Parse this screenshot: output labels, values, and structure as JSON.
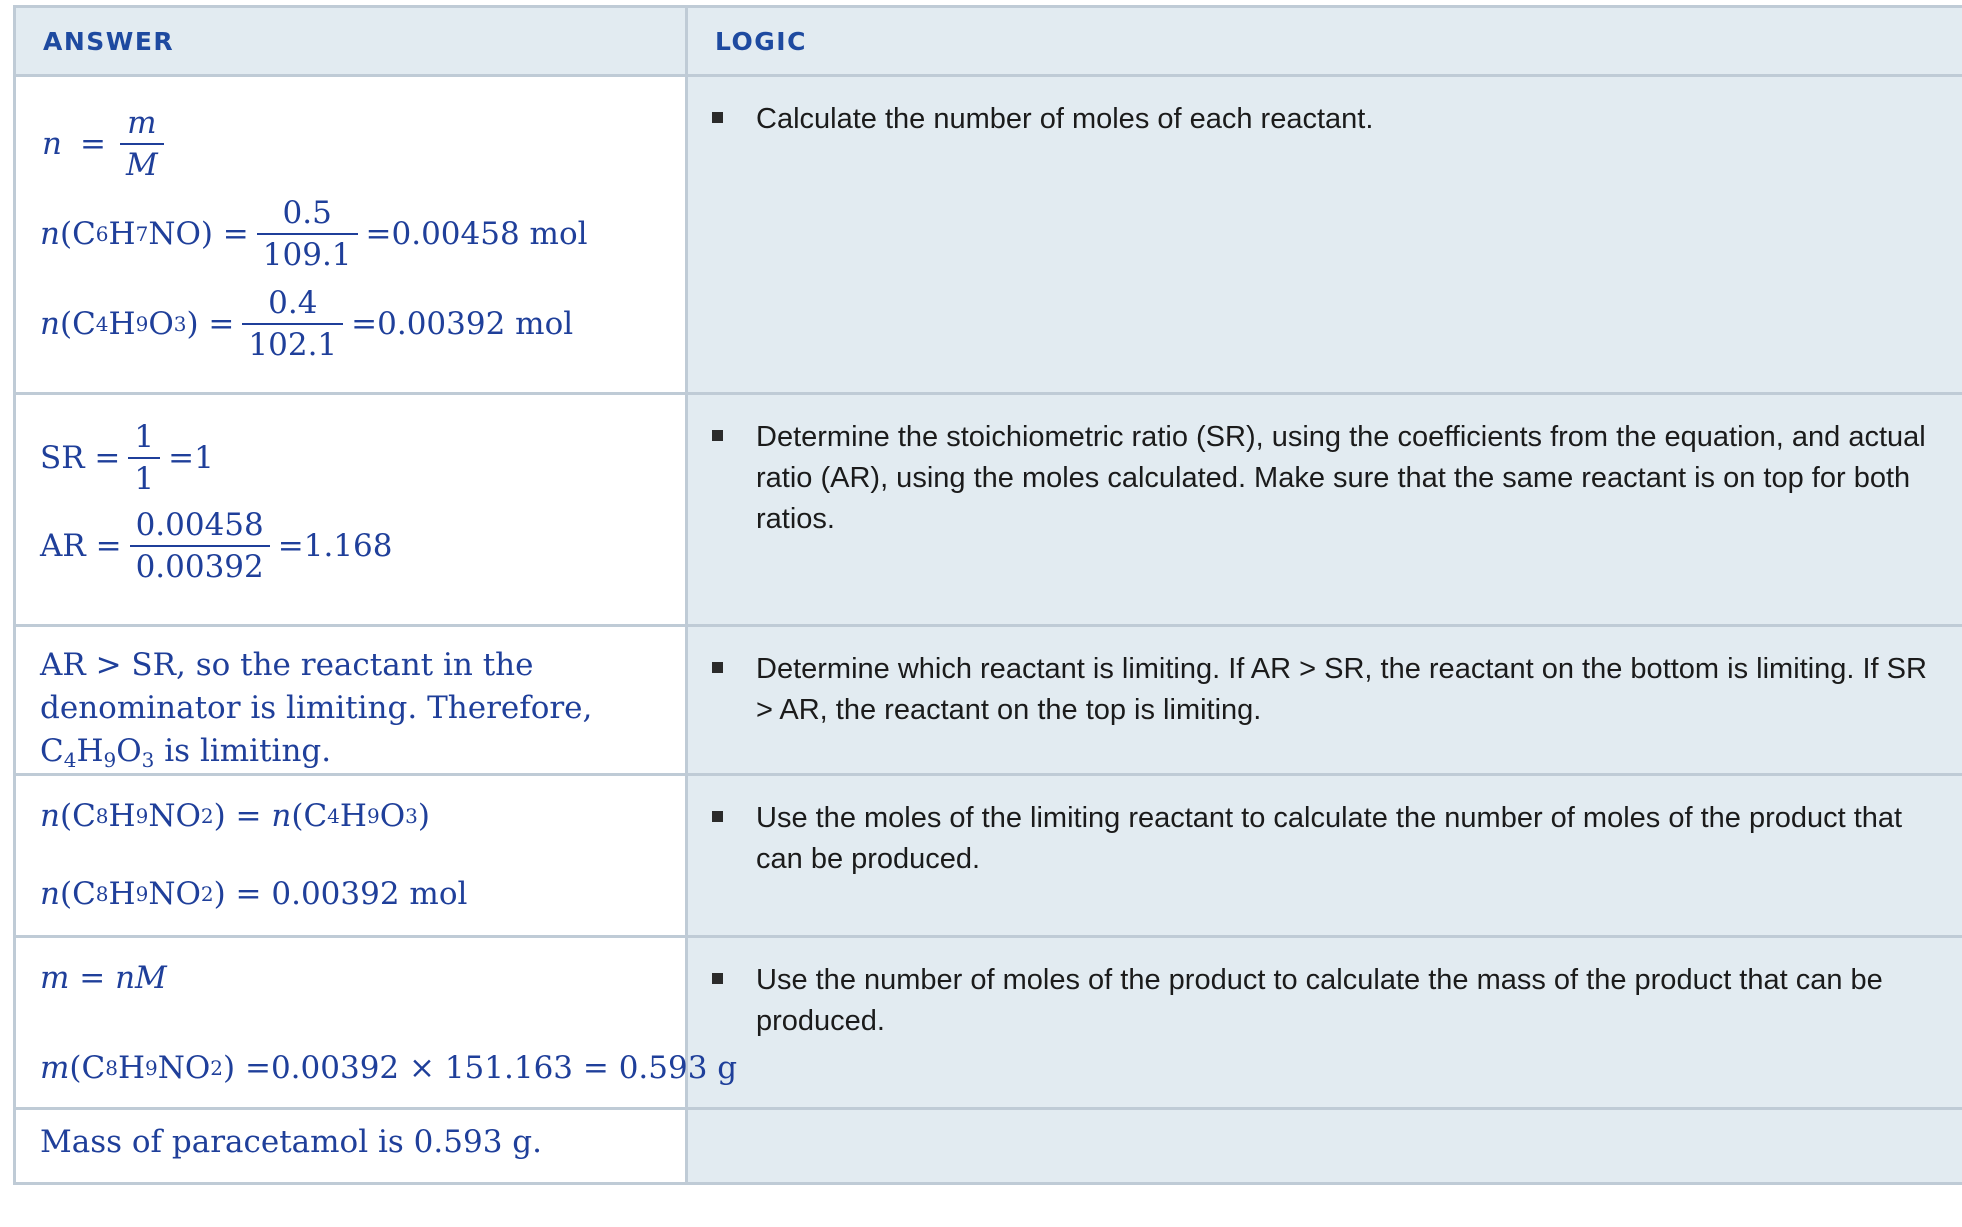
{
  "header": {
    "answer": "ANSWER",
    "logic": "LOGIC"
  },
  "rows": [
    {
      "answer": {
        "l1": {
          "lhs": "n",
          "eq": "=",
          "num": "m",
          "den": "M"
        },
        "l2": {
          "pre": "n",
          "formula_a": "(C",
          "s1": "6",
          "formula_b": "H",
          "s2": "7",
          "formula_c": "NO) =",
          "num": "0.5",
          "den": "109.1",
          "result": "=0.00458 mol"
        },
        "l3": {
          "pre": "n",
          "formula_a": "(C",
          "s1": "4",
          "formula_b": "H",
          "s2": "9",
          "formula_c": "O",
          "s3": "3",
          "formula_d": ") =",
          "num": "0.4",
          "den": "102.1",
          "result": "=0.00392 mol"
        }
      },
      "logic": "Calculate the number of moles of each reactant."
    },
    {
      "answer": {
        "l1": {
          "lhs": "SR =",
          "num": "1",
          "den": "1",
          "result": "=1"
        },
        "l2": {
          "lhs": "AR =",
          "num": "0.00458",
          "den": "0.00392",
          "result": "=1.168"
        }
      },
      "logic": "Determine the stoichiometric ratio (SR), using the coefficients from the equation, and actual ratio (AR), using the moles calculated. Make sure that the same reactant is on top for both ratios."
    },
    {
      "answer": {
        "text1": "AR > SR, so the reactant in the",
        "text2": "denominator is limiting. Therefore,",
        "f_a": "C",
        "s1": "4",
        "f_b": "H",
        "s2": "9",
        "f_c": "O",
        "s3": "3",
        "text3": " is limiting."
      },
      "logic": "Determine which reactant is limiting. If AR > SR, the reactant on the bottom is limiting. If SR > AR, the reactant on the top is limiting."
    },
    {
      "answer": {
        "l1": {
          "pre": "n",
          "a": "(C",
          "s1": "8",
          "b": "H",
          "s2": "9",
          "c": "NO",
          "s3": "2",
          "d": ") = ",
          "pre2": "n",
          "e": "(C",
          "s4": "4",
          "f": "H",
          "s5": "9",
          "g": "O",
          "s6": "3",
          "h": ")"
        },
        "l2": {
          "pre": "n",
          "a": "(C",
          "s1": "8",
          "b": "H",
          "s2": "9",
          "c": "NO",
          "s3": "2",
          "d": ") = 0.00392 mol"
        }
      },
      "logic": "Use the moles of the limiting reactant to calculate the number of moles of the product that can be produced."
    },
    {
      "answer": {
        "l1": "m = nM",
        "l2": {
          "pre": "m",
          "a": "(C",
          "s1": "8",
          "b": "H",
          "s2": "9",
          "c": "NO",
          "s3": "2",
          "d": ") =0.00392 × 151.163 = 0.593 g"
        }
      },
      "logic": "Use the number of moles of the product to calculate the mass of the product that can be produced."
    },
    {
      "answer": {
        "text": "Mass of paracetamol is 0.593 g."
      },
      "logic": ""
    }
  ],
  "colors": {
    "header_text": "#1e4aa0",
    "answer_text": "#1f3f9a",
    "logic_bg": "#e2ebf1",
    "border": "#bfcbd6"
  }
}
